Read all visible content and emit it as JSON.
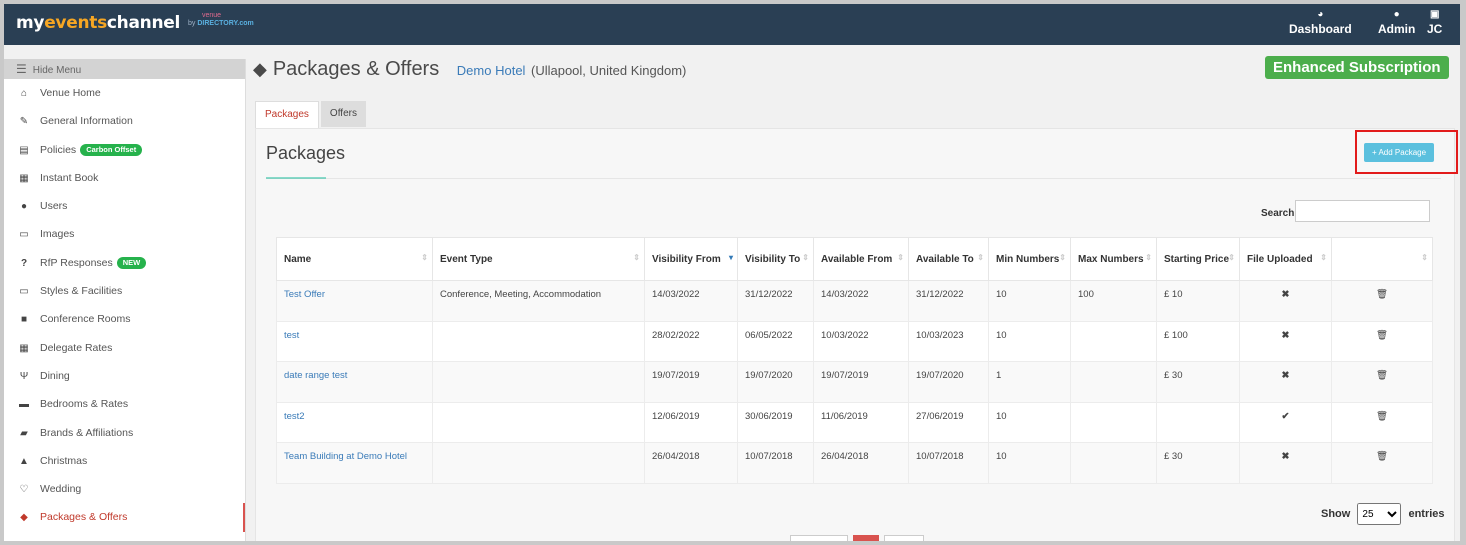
{
  "topbar": {
    "logo_my": "my",
    "logo_events": "events",
    "logo_channel": "channel",
    "logo_by": "by",
    "logo_venue": "venue",
    "logo_directory": "DIRECTORY.com",
    "nav": [
      {
        "label": "Dashboard",
        "icon": "dashboard-icon"
      },
      {
        "label": "Admin",
        "icon": "user-icon"
      },
      {
        "label": "JC",
        "icon": "profile-icon"
      }
    ]
  },
  "sidebar": {
    "hide_menu": "Hide Menu",
    "items": [
      {
        "label": "Venue Home",
        "icon": "home-icon"
      },
      {
        "label": "General Information",
        "icon": "edit-icon"
      },
      {
        "label": "Policies",
        "icon": "document-icon",
        "badge": "Carbon Offset"
      },
      {
        "label": "Instant Book",
        "icon": "calendar-icon"
      },
      {
        "label": "Users",
        "icon": "user-icon"
      },
      {
        "label": "Images",
        "icon": "image-icon"
      },
      {
        "label": "RfP Responses",
        "icon": "question-icon",
        "badge": "NEW"
      },
      {
        "label": "Styles & Facilities",
        "icon": "monitor-icon"
      },
      {
        "label": "Conference Rooms",
        "icon": "briefcase-icon"
      },
      {
        "label": "Delegate Rates",
        "icon": "calculator-icon"
      },
      {
        "label": "Dining",
        "icon": "cutlery-icon"
      },
      {
        "label": "Bedrooms & Rates",
        "icon": "bed-icon"
      },
      {
        "label": "Brands & Affiliations",
        "icon": "book-icon"
      },
      {
        "label": "Christmas",
        "icon": "tree-icon"
      },
      {
        "label": "Wedding",
        "icon": "heart-icon"
      },
      {
        "label": "Packages & Offers",
        "icon": "tags-icon",
        "active": true
      }
    ]
  },
  "page": {
    "title": "Packages & Offers",
    "venue_name": "Demo Hotel",
    "venue_location": "(Ullapool, United Kingdom)",
    "subscription": "Enhanced Subscription"
  },
  "tabs": [
    {
      "label": "Packages",
      "active": true
    },
    {
      "label": "Offers",
      "active": false
    }
  ],
  "panel": {
    "title": "Packages",
    "add_button": "+ Add Package",
    "search_label": "Search:",
    "search_value": ""
  },
  "table": {
    "columns": [
      "Name",
      "Event Type",
      "Visibility From",
      "Visibility To",
      "Available From",
      "Available To",
      "Min Numbers",
      "Max Numbers",
      "Starting Price",
      "File Uploaded",
      ""
    ],
    "rows": [
      {
        "name": "Test Offer",
        "event_type": "Conference, Meeting, Accommodation",
        "vis_from": "14/03/2022",
        "vis_to": "31/12/2022",
        "avail_from": "14/03/2022",
        "avail_to": "31/12/2022",
        "min": "10",
        "max": "100",
        "price": "£ 10",
        "file": "✖"
      },
      {
        "name": "test",
        "event_type": "",
        "vis_from": "28/02/2022",
        "vis_to": "06/05/2022",
        "avail_from": "10/03/2022",
        "avail_to": "10/03/2023",
        "min": "10",
        "max": "",
        "price": "£ 100",
        "file": "✖"
      },
      {
        "name": "date range test",
        "event_type": "",
        "vis_from": "19/07/2019",
        "vis_to": "19/07/2020",
        "avail_from": "19/07/2019",
        "avail_to": "19/07/2020",
        "min": "1",
        "max": "",
        "price": "£ 30",
        "file": "✖"
      },
      {
        "name": "test2",
        "event_type": "",
        "vis_from": "12/06/2019",
        "vis_to": "30/06/2019",
        "avail_from": "11/06/2019",
        "avail_to": "27/06/2019",
        "min": "10",
        "max": "",
        "price": "",
        "file": "✔"
      },
      {
        "name": "Team Building at Demo Hotel",
        "event_type": "",
        "vis_from": "26/04/2018",
        "vis_to": "10/07/2018",
        "avail_from": "26/04/2018",
        "avail_to": "10/07/2018",
        "min": "10",
        "max": "",
        "price": "£ 30",
        "file": "✖"
      }
    ]
  },
  "pagination": {
    "show_label": "Show",
    "entries_value": "25",
    "entries_label": "entries"
  },
  "colors": {
    "topbar": "#2a3f54",
    "accent_red": "#d9534f",
    "link_blue": "#3a7bb8",
    "success_green": "#4cae4c",
    "info_blue": "#5bc0de"
  }
}
